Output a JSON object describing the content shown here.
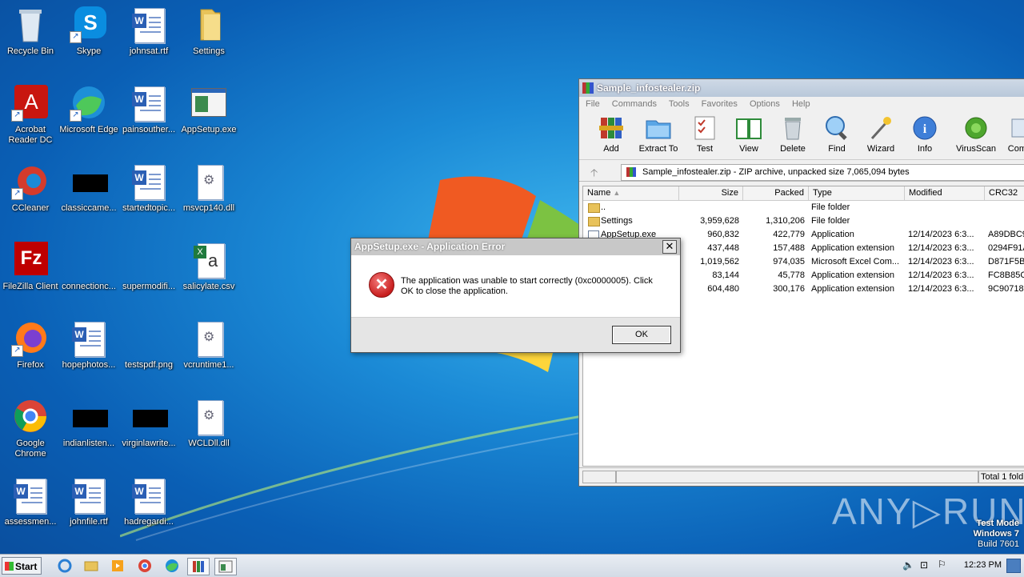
{
  "desktop": {
    "icons": [
      {
        "label": "Recycle Bin"
      },
      {
        "label": "Skype"
      },
      {
        "label": "johnsat.rtf"
      },
      {
        "label": "Settings"
      },
      {
        "label": "Acrobat Reader DC"
      },
      {
        "label": "Microsoft Edge"
      },
      {
        "label": "painsouther..."
      },
      {
        "label": "AppSetup.exe"
      },
      {
        "label": "CCleaner"
      },
      {
        "label": "classiccame..."
      },
      {
        "label": "startedtopic..."
      },
      {
        "label": "msvcp140.dll"
      },
      {
        "label": "FileZilla Client"
      },
      {
        "label": "connectionc..."
      },
      {
        "label": "supermodifi..."
      },
      {
        "label": "salicylate.csv"
      },
      {
        "label": "Firefox"
      },
      {
        "label": "hopephotos..."
      },
      {
        "label": "testspdf.png"
      },
      {
        "label": "vcruntime1..."
      },
      {
        "label": "Google Chrome"
      },
      {
        "label": "indianlisten..."
      },
      {
        "label": "virginlawrite..."
      },
      {
        "label": "WCLDll.dll"
      },
      {
        "label": "assessmen..."
      },
      {
        "label": "johnfile.rtf"
      },
      {
        "label": "hadregardi..."
      }
    ]
  },
  "winrar": {
    "title": "Sample_infostealer.zip",
    "menu": [
      "File",
      "Commands",
      "Tools",
      "Favorites",
      "Options",
      "Help"
    ],
    "toolbar": [
      "Add",
      "Extract To",
      "Test",
      "View",
      "Delete",
      "Find",
      "Wizard",
      "Info",
      "VirusScan",
      "Comm"
    ],
    "address": "Sample_infostealer.zip - ZIP archive, unpacked size 7,065,094 bytes",
    "columns": {
      "name": "Name",
      "size": "Size",
      "packed": "Packed",
      "type": "Type",
      "modified": "Modified",
      "crc": "CRC32"
    },
    "rows": [
      {
        "name": "..",
        "size": "",
        "packed": "",
        "type": "File folder",
        "modified": "",
        "crc": ""
      },
      {
        "name": "Settings",
        "size": "3,959,628",
        "packed": "1,310,206",
        "type": "File folder",
        "modified": "",
        "crc": ""
      },
      {
        "name": "AppSetup.exe",
        "size": "960,832",
        "packed": "422,779",
        "type": "Application",
        "modified": "12/14/2023 6:3...",
        "crc": "A89DBC9"
      },
      {
        "name": "",
        "size": "437,448",
        "packed": "157,488",
        "type": "Application extension",
        "modified": "12/14/2023 6:3...",
        "crc": "0294F91A"
      },
      {
        "name": "",
        "size": "1,019,562",
        "packed": "974,035",
        "type": "Microsoft Excel Com...",
        "modified": "12/14/2023 6:3...",
        "crc": "D871F5B"
      },
      {
        "name": "",
        "size": "83,144",
        "packed": "45,778",
        "type": "Application extension",
        "modified": "12/14/2023 6:3...",
        "crc": "FC8B85C"
      },
      {
        "name": "",
        "size": "604,480",
        "packed": "300,176",
        "type": "Application extension",
        "modified": "12/14/2023 6:3...",
        "crc": "9C90718"
      }
    ],
    "status_right": "Total 1 fold"
  },
  "dialog": {
    "title": "AppSetup.exe - Application Error",
    "message": "The application was unable to start correctly (0xc0000005). Click OK to close the application.",
    "ok_label": "OK",
    "close_glyph": "✕"
  },
  "watermark": "ANY▷RUN",
  "testmode": {
    "line1": "Test Mode",
    "line2": "Windows 7",
    "line3": "Build 7601"
  },
  "taskbar": {
    "start_label": "Start",
    "clock": "12:23 PM"
  }
}
